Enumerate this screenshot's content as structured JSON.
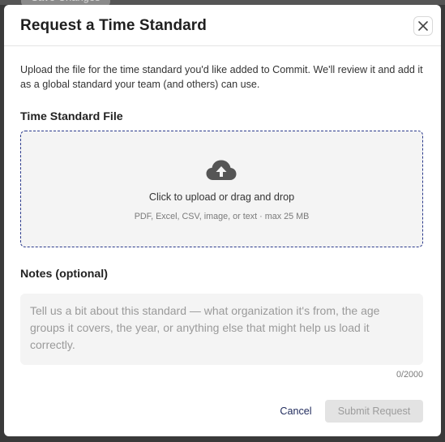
{
  "background": {
    "partial_button_label": "Save Changes"
  },
  "dialog": {
    "title": "Request a Time Standard",
    "description": "Upload the file for the time standard you'd like added to Commit. We'll review it and add it as a global standard your team (and others) can use.",
    "file_section": {
      "label": "Time Standard File",
      "primary_text": "Click to upload or drag and drop",
      "secondary_text": "PDF, Excel, CSV, image, or text · max 25 MB",
      "icon": "cloud-upload-icon"
    },
    "notes_section": {
      "label": "Notes (optional)",
      "placeholder": "Tell us a bit about this standard — what organization it's from, the age groups it covers, the year, or anything else that might help us load it correctly.",
      "value": "",
      "counter": "0/2000"
    },
    "actions": {
      "cancel_label": "Cancel",
      "submit_label": "Submit Request"
    },
    "close_icon": "close-icon"
  },
  "colors": {
    "dropzone_border": "#2b3a8c",
    "cancel_text": "#1f2a5c",
    "submit_disabled_bg": "#e3e3e3",
    "submit_disabled_text": "#9c9c9c",
    "backdrop": "#3a3a3a"
  }
}
